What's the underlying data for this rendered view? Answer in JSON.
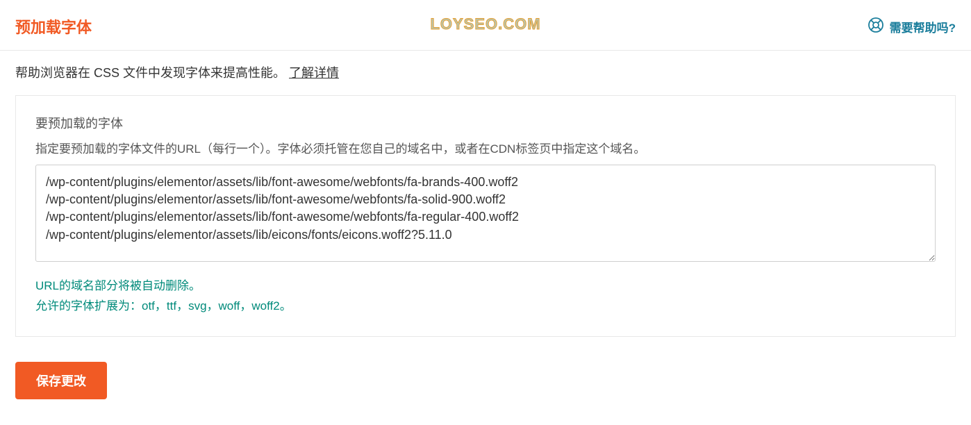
{
  "header": {
    "title": "预加载字体",
    "watermark": "LOYSEO.COM",
    "help_label": "需要帮助吗?"
  },
  "description": {
    "text": "帮助浏览器在 CSS 文件中发现字体来提高性能。 ",
    "learn_more": "了解详情"
  },
  "form": {
    "label": "要预加载的字体",
    "help": "指定要预加载的字体文件的URL（每行一个）。字体必须托管在您自己的域名中，或者在CDN标签页中指定这个域名。",
    "textarea_value": "/wp-content/plugins/elementor/assets/lib/font-awesome/webfonts/fa-brands-400.woff2\n/wp-content/plugins/elementor/assets/lib/font-awesome/webfonts/fa-solid-900.woff2\n/wp-content/plugins/elementor/assets/lib/font-awesome/webfonts/fa-regular-400.woff2\n/wp-content/plugins/elementor/assets/lib/eicons/fonts/eicons.woff2?5.11.0",
    "hint1": "URL的域名部分将被自动删除。",
    "hint2": "允许的字体扩展为：otf，ttf，svg，woff，woff2。"
  },
  "actions": {
    "save_label": "保存更改"
  }
}
